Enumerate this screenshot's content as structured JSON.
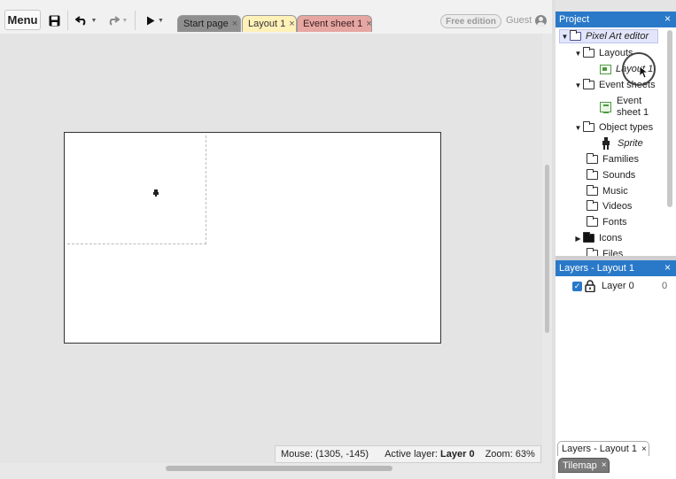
{
  "toolbar": {
    "menu_label": "Menu",
    "save_icon": "save-icon",
    "undo_icon": "undo-icon",
    "redo_icon": "redo-icon",
    "play_icon": "play-icon",
    "free_edition": "Free edition",
    "guest": "Guest"
  },
  "tabs": [
    {
      "label": "Start page",
      "close": "×",
      "color": "#8f8f8f"
    },
    {
      "label": "Layout 1",
      "close": "×",
      "color": "#fff1b8"
    },
    {
      "label": "Event sheet 1",
      "close": "×",
      "color": "#e6a6a2"
    }
  ],
  "status": {
    "mouse": "Mouse: (1305, -145)",
    "active_layer_prefix": "Active layer:",
    "active_layer": "Layer 0",
    "zoom": "Zoom: 63%"
  },
  "project": {
    "title": "Project",
    "close": "×",
    "root": "Pixel Art editor",
    "layouts_folder": "Layouts",
    "layout_item": "Layout 1",
    "event_sheets_folder": "Event sheets",
    "event_item_line1": "Event",
    "event_item_line2": "sheet 1",
    "object_types_folder": "Object types",
    "sprite_item": "Sprite",
    "families": "Families",
    "sounds": "Sounds",
    "music": "Music",
    "videos": "Videos",
    "fonts": "Fonts",
    "icons": "Icons",
    "files": "Files"
  },
  "layers": {
    "title": "Layers - Layout 1",
    "close": "×",
    "checkbox": "✓",
    "layer_name": "Layer 0",
    "layer_count": "0"
  },
  "bottom_tabs": {
    "layers_tab": "Layers - Layout 1",
    "tilemap_tab": "Tilemap",
    "close": "×"
  },
  "colors": {
    "panel_header": "#2a79c9",
    "accent_green": "#4b9a3d"
  }
}
